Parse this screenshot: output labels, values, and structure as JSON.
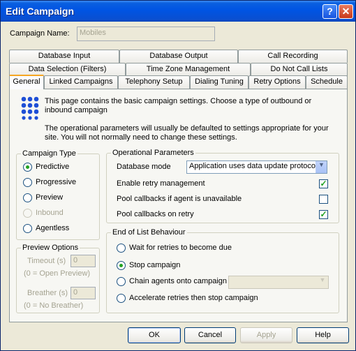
{
  "window": {
    "title": "Edit Campaign",
    "help_glyph": "?",
    "close_glyph": "✕"
  },
  "campaign_name": {
    "label": "Campaign Name:",
    "value": "Mobiles"
  },
  "tabs": {
    "row1": [
      "Database Input",
      "Database Output",
      "Call Recording"
    ],
    "row2": [
      "Data Selection (Filters)",
      "Time Zone Management",
      "Do Not Call Lists"
    ],
    "row3": [
      "General",
      "Linked Campaigns",
      "Telephony Setup",
      "Dialing Tuning",
      "Retry Options",
      "Schedule"
    ],
    "active": "General"
  },
  "info": {
    "icon": "dots-grid-icon",
    "line1": "This page contains the basic campaign settings. Choose a type of outbound or inbound campaign",
    "line2": "The operational parameters will usually be defaulted to settings appropriate for your site. You will not normally need to change these settings."
  },
  "campaign_type": {
    "title": "Campaign Type",
    "options": [
      {
        "label": "Predictive",
        "checked": true,
        "enabled": true
      },
      {
        "label": "Progressive",
        "checked": false,
        "enabled": true
      },
      {
        "label": "Preview",
        "checked": false,
        "enabled": true
      },
      {
        "label": "Inbound",
        "checked": false,
        "enabled": false
      },
      {
        "label": "Agentless",
        "checked": false,
        "enabled": true
      }
    ]
  },
  "preview_options": {
    "title": "Preview Options",
    "timeout_label": "Timeout (s)",
    "timeout_value": "0",
    "timeout_note": "(0 = Open Preview)",
    "breather_label": "Breather (s)",
    "breather_value": "0",
    "breather_note": "(0 = No Breather)"
  },
  "operational": {
    "title": "Operational Parameters",
    "db_mode_label": "Database mode",
    "db_mode_value": "Application uses data update protocol",
    "checks": [
      {
        "label": "Enable retry management",
        "checked": true
      },
      {
        "label": "Pool callbacks if agent is unavailable",
        "checked": false
      },
      {
        "label": "Pool callbacks on retry",
        "checked": true
      }
    ]
  },
  "end_of_list": {
    "title": "End of List Behaviour",
    "options": [
      {
        "label": "Wait for retries to become due",
        "checked": false
      },
      {
        "label": "Stop campaign",
        "checked": true
      },
      {
        "label": "Chain agents onto campaign",
        "checked": false
      },
      {
        "label": "Accelerate retries then stop campaign",
        "checked": false
      }
    ],
    "chain_combo_value": ""
  },
  "buttons": {
    "ok": "OK",
    "cancel": "Cancel",
    "apply": "Apply",
    "help": "Help"
  },
  "colors": {
    "title_bar": "#0054e3",
    "dialog_bg": "#ece9d8",
    "icon_blue": "#1e4fd6",
    "check_green": "#21a121"
  }
}
